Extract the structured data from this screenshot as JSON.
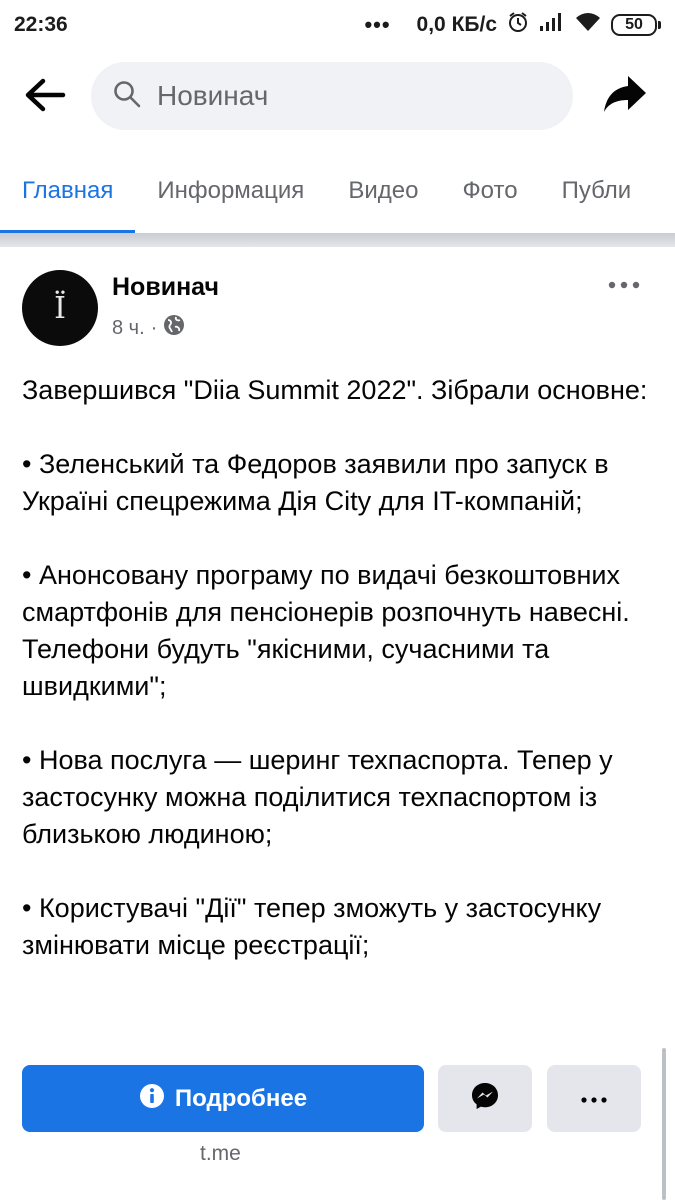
{
  "status_bar": {
    "time": "22:36",
    "dots": "•••",
    "network_speed": "0,0 КБ/с",
    "battery": "50",
    "icons": [
      "alarm-icon",
      "signal-icon",
      "wifi-icon",
      "battery-icon"
    ]
  },
  "header": {
    "search_text": "Новинач",
    "icons": [
      "back-arrow-icon",
      "search-icon",
      "share-icon"
    ]
  },
  "tabs": [
    {
      "label": "Главная",
      "active": true
    },
    {
      "label": "Информация",
      "active": false
    },
    {
      "label": "Видео",
      "active": false
    },
    {
      "label": "Фото",
      "active": false
    },
    {
      "label": "Публи",
      "active": false
    }
  ],
  "post": {
    "author": "Новинач",
    "avatar_letter": "Ї",
    "time": "8 ч.",
    "separator": "·",
    "audience_icon": "globe-icon",
    "text": "Завершився \"Diia Summit 2022\". Зібрали основне:\n\n• Зеленський та Федоров заявили про запуск в Україні спецрежима Дія City для IT-компаній;\n\n• Анонсовану програму по видачі безкоштовних смартфонів для пенсіонерів розпочнуть навесні. Телефони будуть \"якісними, сучасними та швидкими\";\n\n• Нова послуга — шеринг техпаспорта. Тепер у застосунку можна поділитися техпаспортом із близькою людиною;\n\n• Користувачі \"Дії\" тепер зможуть у застосунку змінювати місце реєстрації;"
  },
  "link_bar": {
    "more_label": "Подробнее",
    "domain": "t.me",
    "icons": [
      "info-icon",
      "messenger-icon",
      "more-icon"
    ]
  },
  "colors": {
    "accent": "#1b74e4",
    "secondary_text": "#65676b",
    "button_gray": "#e4e6eb",
    "search_bg": "#f0f2f5"
  }
}
